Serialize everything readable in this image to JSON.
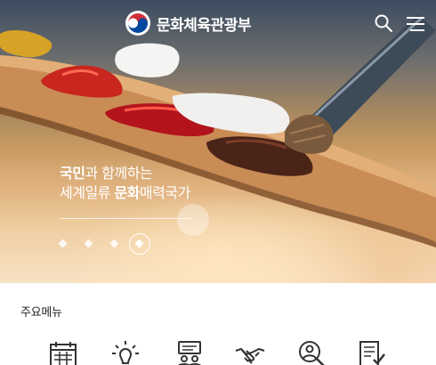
{
  "header": {
    "logo_text": "문화체육관광부",
    "logo_icon": "taegeuk-emblem-icon",
    "search_icon": "search-icon",
    "menu_icon": "hamburger-menu-icon"
  },
  "hero": {
    "slogan_line1_bold": "국민",
    "slogan_line1_rest": "과 함께하는",
    "slogan_line2_pre": "세계일류 ",
    "slogan_line2_bold": "문화",
    "slogan_line2_post": "매력국가",
    "slides_total": 4,
    "slide_active": 4,
    "slide_progress": 0.9
  },
  "main_menu": {
    "title": "주요메뉴",
    "items": [
      {
        "icon": "calendar-icon"
      },
      {
        "icon": "lightbulb-icon"
      },
      {
        "icon": "discussion-icon"
      },
      {
        "icon": "handshake-icon"
      },
      {
        "icon": "person-search-icon"
      },
      {
        "icon": "document-check-icon"
      }
    ]
  },
  "colors": {
    "emblem_red": "#cd2e3a",
    "emblem_blue": "#0047a0",
    "text_dark": "#222222",
    "icon_stroke": "#333333"
  }
}
